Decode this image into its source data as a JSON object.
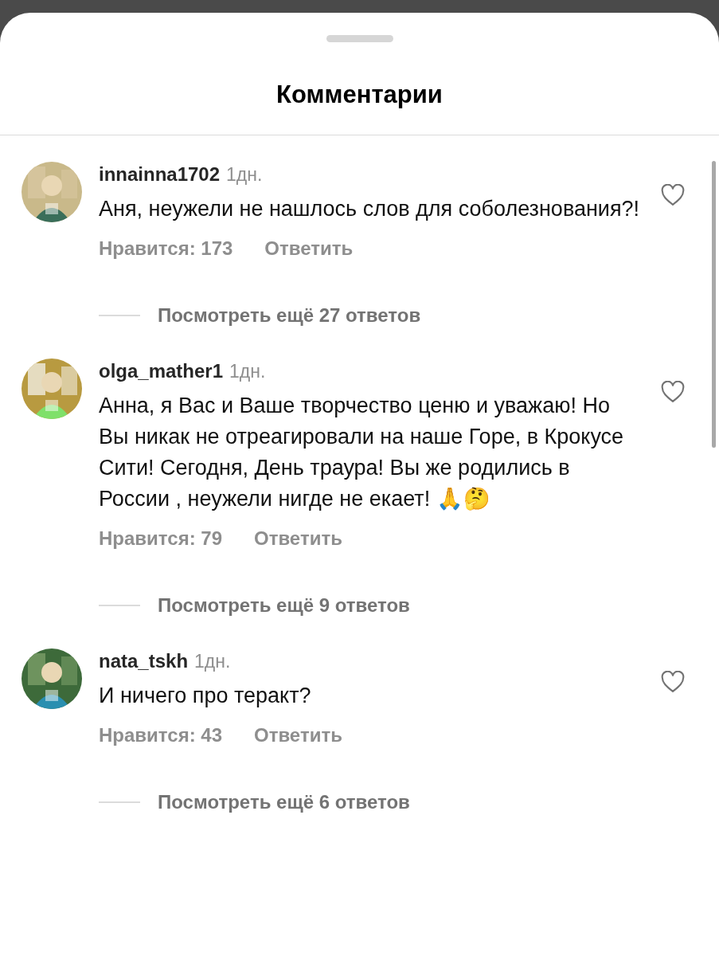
{
  "sheet": {
    "title": "Комментарии"
  },
  "comments": [
    {
      "username": "innainna1702",
      "time": "1дн.",
      "text": "Аня, неужели не нашлось слов для соболезнования?!",
      "likes": "Нравится: 173",
      "reply": "Ответить",
      "more_replies": "Посмотреть ещё 27 ответов",
      "liked": false
    },
    {
      "username": "olga_mather1",
      "time": "1дн.",
      "text": "Анна, я Вас и Ваше творчество ценю и уважаю! Но Вы никак не отреагировали на наше Горе, в Крокусе Сити! Сегодня, День траура! Вы же родились в России , неужели нигде не екает! 🙏🤔",
      "likes": "Нравится: 79",
      "reply": "Ответить",
      "more_replies": "Посмотреть ещё 9 ответов",
      "liked": false
    },
    {
      "username": "nata_tskh",
      "time": "1дн.",
      "text": "И ничего про теракт?",
      "likes": "Нравится: 43",
      "reply": "Ответить",
      "more_replies": "Посмотреть ещё 6 ответов",
      "liked": false
    }
  ]
}
